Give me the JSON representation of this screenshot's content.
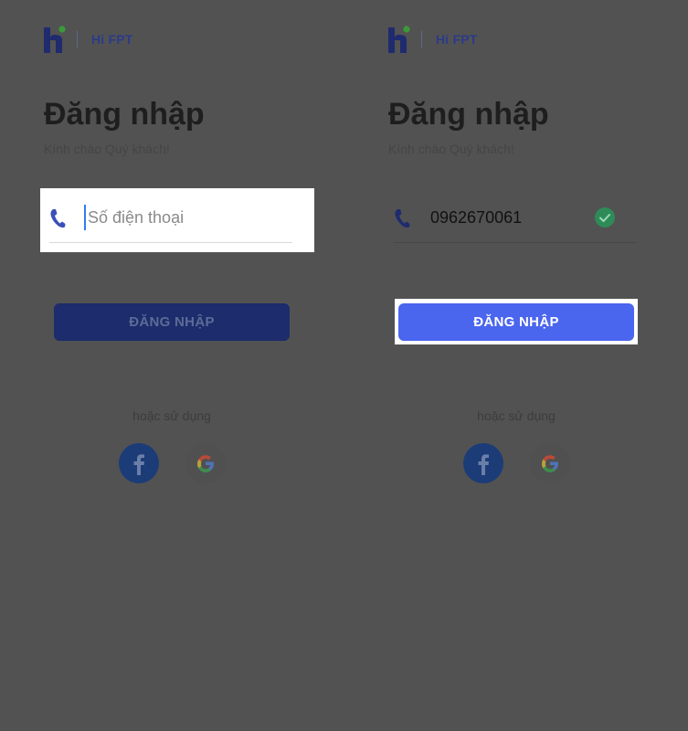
{
  "brand": {
    "name": "Hi FPT",
    "logo_icon": "hi-fpt-logo",
    "color": "#2b3b8a"
  },
  "login_screens": [
    {
      "title": "Đăng nhập",
      "subtitle": "Kính chào Quý khách!",
      "phone_placeholder": "Số điện thoại",
      "phone_value": "",
      "phone_icon": "phone-icon",
      "button_label": "ĐĂNG NHẬP",
      "button_enabled": false,
      "or_use_label": "hoặc sử dụng",
      "social": [
        "facebook-icon",
        "google-icon"
      ]
    },
    {
      "title": "Đăng nhập",
      "subtitle": "Kính chào Quý khách!",
      "phone_placeholder": "Số điện thoại",
      "phone_value": "0962670061",
      "phone_icon": "phone-icon",
      "valid_icon": "check-icon",
      "button_label": "ĐĂNG NHẬP",
      "button_enabled": true,
      "or_use_label": "hoặc sử dụng",
      "social": [
        "facebook-icon",
        "google-icon"
      ]
    }
  ],
  "colors": {
    "overlay_background": "#525252",
    "button_active": "#4a65ee",
    "button_inactive": "#1c2c6c",
    "valid_check": "#2e8b57",
    "facebook": "#1c3c78"
  }
}
